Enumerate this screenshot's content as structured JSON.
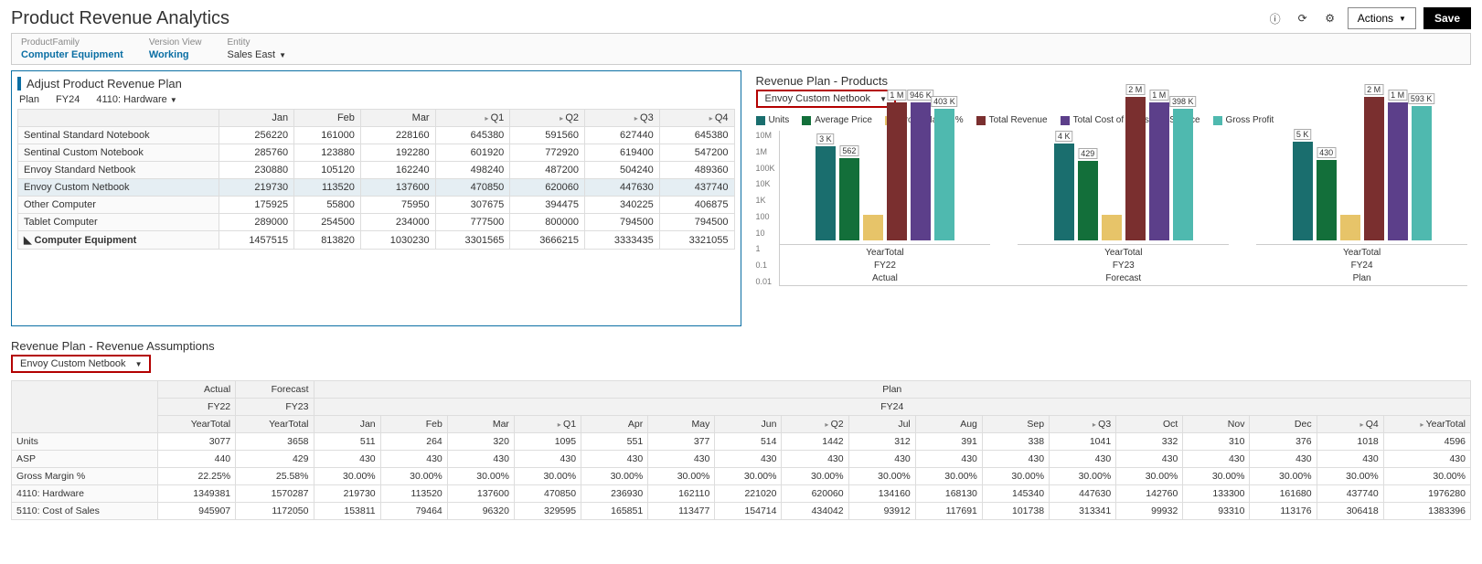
{
  "header": {
    "title": "Product Revenue Analytics",
    "actions_label": "Actions",
    "save_label": "Save"
  },
  "pov": {
    "productFamily": {
      "label": "ProductFamily",
      "value": "Computer Equipment"
    },
    "versionView": {
      "label": "Version View",
      "value": "Working"
    },
    "entity": {
      "label": "Entity",
      "value": "Sales East"
    }
  },
  "plan_panel": {
    "title": "Adjust Product Revenue Plan",
    "pov": [
      "Plan",
      "FY24",
      "4110: Hardware"
    ],
    "columns": [
      "Jan",
      "Feb",
      "Mar",
      "Q1",
      "Q2",
      "Q3",
      "Q4"
    ],
    "rows": [
      {
        "label": "Sentinal Standard Notebook",
        "vals": [
          "256220",
          "161000",
          "228160",
          "645380",
          "591560",
          "627440",
          "645380"
        ]
      },
      {
        "label": "Sentinal Custom Notebook",
        "vals": [
          "285760",
          "123880",
          "192280",
          "601920",
          "772920",
          "619400",
          "547200"
        ]
      },
      {
        "label": "Envoy Standard Netbook",
        "vals": [
          "230880",
          "105120",
          "162240",
          "498240",
          "487200",
          "504240",
          "489360"
        ]
      },
      {
        "label": "Envoy Custom Netbook",
        "vals": [
          "219730",
          "113520",
          "137600",
          "470850",
          "620060",
          "447630",
          "437740"
        ],
        "selected": true
      },
      {
        "label": "Other Computer",
        "vals": [
          "175925",
          "55800",
          "75950",
          "307675",
          "394475",
          "340225",
          "406875"
        ]
      },
      {
        "label": "Tablet Computer",
        "vals": [
          "289000",
          "254500",
          "234000",
          "777500",
          "800000",
          "794500",
          "794500"
        ]
      },
      {
        "label": "Computer Equipment",
        "vals": [
          "1457515",
          "813820",
          "1030230",
          "3301565",
          "3666215",
          "3333435",
          "3321055"
        ],
        "bold": true
      }
    ]
  },
  "chart_panel": {
    "title": "Revenue Plan - Products",
    "product": "Envoy Custom Netbook",
    "legend": [
      {
        "name": "Units",
        "color": "#1a6e6e"
      },
      {
        "name": "Average Price",
        "color": "#136f3a"
      },
      {
        "name": "Gross Margin %",
        "color": "#e7c469"
      },
      {
        "name": "Total Revenue",
        "color": "#7a2f2f"
      },
      {
        "name": "Total Cost of Sales and Service",
        "color": "#5c3f8a"
      },
      {
        "name": "Gross Profit",
        "color": "#4fb9af"
      }
    ]
  },
  "chart_data": {
    "type": "bar",
    "yscale": "log",
    "ylabel": "",
    "yticks": [
      "10M",
      "1M",
      "100K",
      "10K",
      "1K",
      "100",
      "10",
      "1",
      "0.1",
      "0.01"
    ],
    "categories": [
      "FY22 Actual",
      "FY23 Forecast",
      "FY24 Plan"
    ],
    "category_header": "YearTotal",
    "series": [
      {
        "name": "Units",
        "values": [
          3000,
          4000,
          5000
        ],
        "labels": [
          "3 K",
          "4 K",
          "5 K"
        ],
        "color": "#1a6e6e"
      },
      {
        "name": "Average Price",
        "values": [
          562,
          429,
          430
        ],
        "labels": [
          "562",
          "429",
          "430"
        ],
        "color": "#136f3a"
      },
      {
        "name": "Gross Margin %",
        "values": [
          0.3,
          0.3,
          0.3
        ],
        "labels": [
          "",
          "",
          ""
        ],
        "color": "#e7c469"
      },
      {
        "name": "Total Revenue",
        "values": [
          1000000,
          2000000,
          2000000
        ],
        "labels": [
          "1 M",
          "2 M",
          "2 M"
        ],
        "color": "#7a2f2f"
      },
      {
        "name": "Total Cost of Sales and Service",
        "values": [
          946000,
          1000000,
          1000000
        ],
        "labels": [
          "946 K",
          "1 M",
          "1 M"
        ],
        "color": "#5c3f8a"
      },
      {
        "name": "Gross Profit",
        "values": [
          403000,
          398000,
          593000
        ],
        "labels": [
          "403 K",
          "398 K",
          "593 K"
        ],
        "color": "#4fb9af"
      }
    ]
  },
  "assumptions": {
    "title": "Revenue Plan - Revenue Assumptions",
    "product": "Envoy Custom Netbook",
    "top_headers": [
      "Actual",
      "Forecast",
      "Plan"
    ],
    "mid_headers": [
      "FY22",
      "FY23",
      "FY24"
    ],
    "columns": [
      "YearTotal",
      "YearTotal",
      "Jan",
      "Feb",
      "Mar",
      "Q1",
      "Apr",
      "May",
      "Jun",
      "Q2",
      "Jul",
      "Aug",
      "Sep",
      "Q3",
      "Oct",
      "Nov",
      "Dec",
      "Q4",
      "YearTotal"
    ],
    "rows": [
      {
        "label": "Units",
        "vals": [
          "3077",
          "3658",
          "511",
          "264",
          "320",
          "1095",
          "551",
          "377",
          "514",
          "1442",
          "312",
          "391",
          "338",
          "1041",
          "332",
          "310",
          "376",
          "1018",
          "4596"
        ]
      },
      {
        "label": "ASP",
        "vals": [
          "440",
          "429",
          "430",
          "430",
          "430",
          "430",
          "430",
          "430",
          "430",
          "430",
          "430",
          "430",
          "430",
          "430",
          "430",
          "430",
          "430",
          "430",
          "430"
        ]
      },
      {
        "label": "Gross Margin %",
        "vals": [
          "22.25%",
          "25.58%",
          "30.00%",
          "30.00%",
          "30.00%",
          "30.00%",
          "30.00%",
          "30.00%",
          "30.00%",
          "30.00%",
          "30.00%",
          "30.00%",
          "30.00%",
          "30.00%",
          "30.00%",
          "30.00%",
          "30.00%",
          "30.00%",
          "30.00%"
        ]
      },
      {
        "label": "4110: Hardware",
        "vals": [
          "1349381",
          "1570287",
          "219730",
          "113520",
          "137600",
          "470850",
          "236930",
          "162110",
          "221020",
          "620060",
          "134160",
          "168130",
          "145340",
          "447630",
          "142760",
          "133300",
          "161680",
          "437740",
          "1976280"
        ]
      },
      {
        "label": "5110: Cost of Sales",
        "vals": [
          "945907",
          "1172050",
          "153811",
          "79464",
          "96320",
          "329595",
          "165851",
          "113477",
          "154714",
          "434042",
          "93912",
          "117691",
          "101738",
          "313341",
          "99932",
          "93310",
          "113176",
          "306418",
          "1383396"
        ]
      }
    ]
  }
}
